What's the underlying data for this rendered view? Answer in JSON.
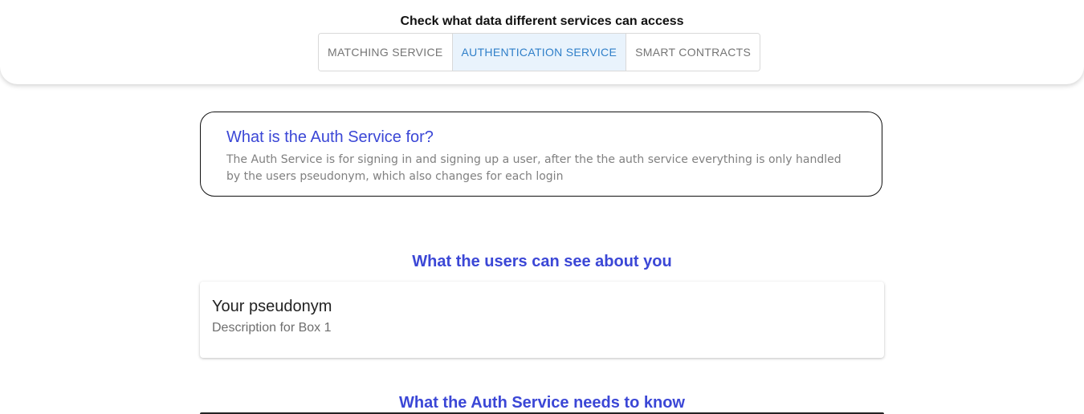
{
  "header": {
    "title": "Check what data different services can access",
    "tabs": [
      {
        "label": "MATCHING SERVICE",
        "active": false
      },
      {
        "label": "AUTHENTICATION SERVICE",
        "active": true
      },
      {
        "label": "SMART CONTRACTS",
        "active": false
      }
    ]
  },
  "info": {
    "title": "What is the Auth Service for?",
    "text": "The Auth Service is for signing in and signing up a user, after the the auth service everything is only handled by the users pseudonym, which also changes for each login"
  },
  "sections": [
    {
      "title": "What the users can see about you",
      "cards": [
        {
          "title": "Your pseudonym",
          "description": "Description for Box 1"
        }
      ]
    },
    {
      "title": "What the Auth Service needs to know"
    }
  ],
  "colors": {
    "accent": "#3b47d6",
    "tab_active_text": "#2f7fc9",
    "tab_active_bg": "#e9f3fc"
  }
}
